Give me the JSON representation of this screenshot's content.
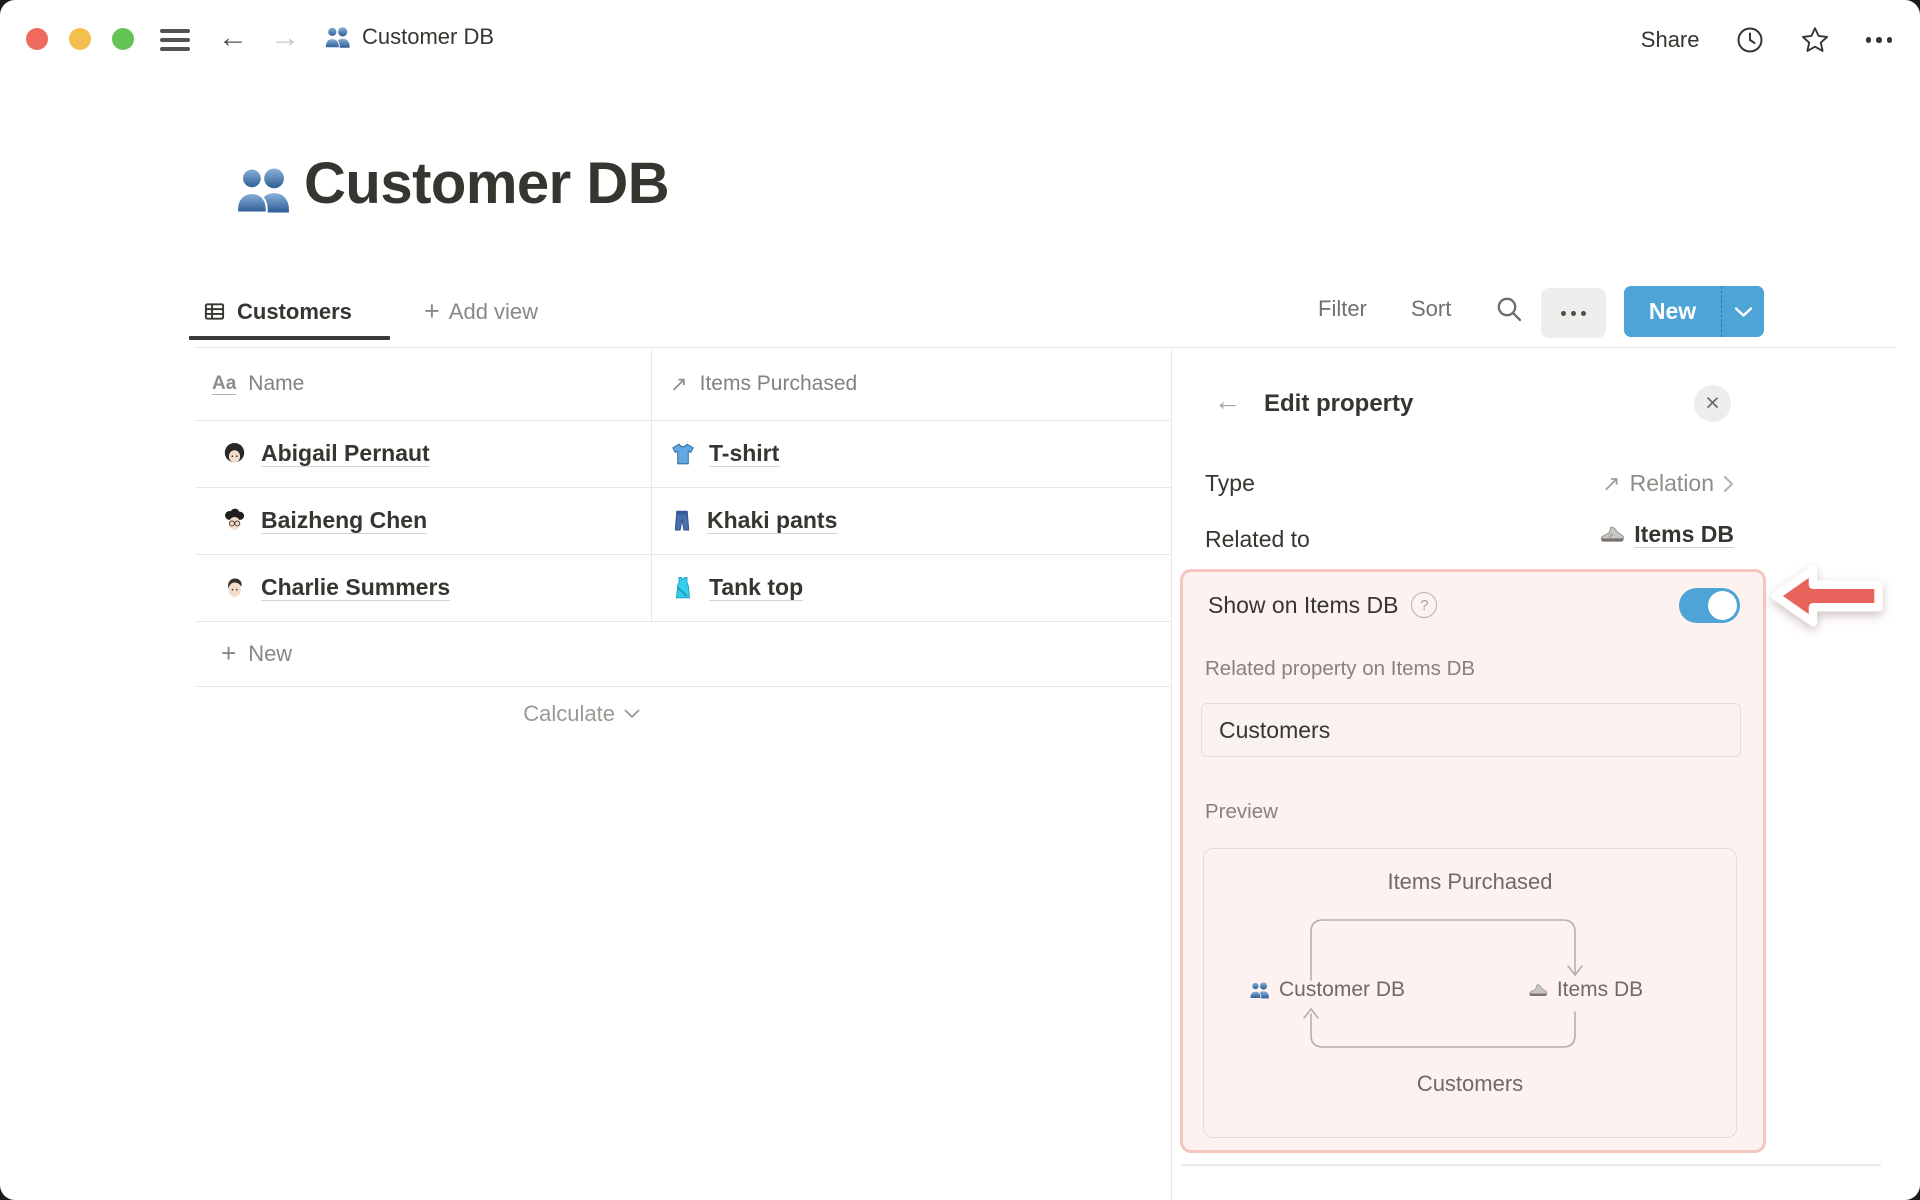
{
  "topbar": {
    "title": "Customer DB",
    "share_label": "Share"
  },
  "page": {
    "title": "Customer DB"
  },
  "toolbar": {
    "active_view": "Customers",
    "add_view_label": "Add view",
    "filter_label": "Filter",
    "sort_label": "Sort",
    "new_label": "New"
  },
  "table": {
    "columns": [
      {
        "label": "Name",
        "icon": "text-type-icon"
      },
      {
        "label": "Items Purchased",
        "icon": "relation-arrow-icon"
      }
    ],
    "rows": [
      {
        "name": "Abigail Pernaut",
        "avatar": "woman-bob-avatar",
        "item": "T-shirt",
        "item_icon": "tshirt-icon"
      },
      {
        "name": "Baizheng Chen",
        "avatar": "curly-hair-glasses-avatar",
        "item": "Khaki pants",
        "item_icon": "jeans-icon"
      },
      {
        "name": "Charlie Summers",
        "avatar": "side-part-hair-avatar",
        "item": "Tank top",
        "item_icon": "tanktop-icon"
      }
    ],
    "new_row_label": "New",
    "calculate_label": "Calculate"
  },
  "panel": {
    "title": "Edit property",
    "type_label": "Type",
    "type_value": "Relation",
    "related_label": "Related to",
    "related_value": "Items DB",
    "show_label": "Show on Items DB",
    "show_enabled": true,
    "help_glyph": "?",
    "related_property_label": "Related property on Items DB",
    "related_property_value": "Customers",
    "preview_label": "Preview",
    "preview": {
      "top_relation": "Items Purchased",
      "left_db": "Customer DB",
      "right_db": "Items DB",
      "bottom_relation": "Customers"
    }
  },
  "glyphs": {
    "back": "←",
    "forward": "→",
    "relation": "↗",
    "close": "×",
    "plus": "+"
  },
  "colors": {
    "accent_blue": "#4ea3d7",
    "highlight_border": "#f4c6bf",
    "highlight_bg": "#fdf2ef",
    "arrow_red": "#e9635d",
    "traffic_red": "#ee6a5e",
    "traffic_yellow": "#f5bf4f",
    "traffic_green": "#61c454",
    "text_primary": "#37352f",
    "text_gray": "#84827d",
    "border_gray": "#e9e8e6"
  }
}
